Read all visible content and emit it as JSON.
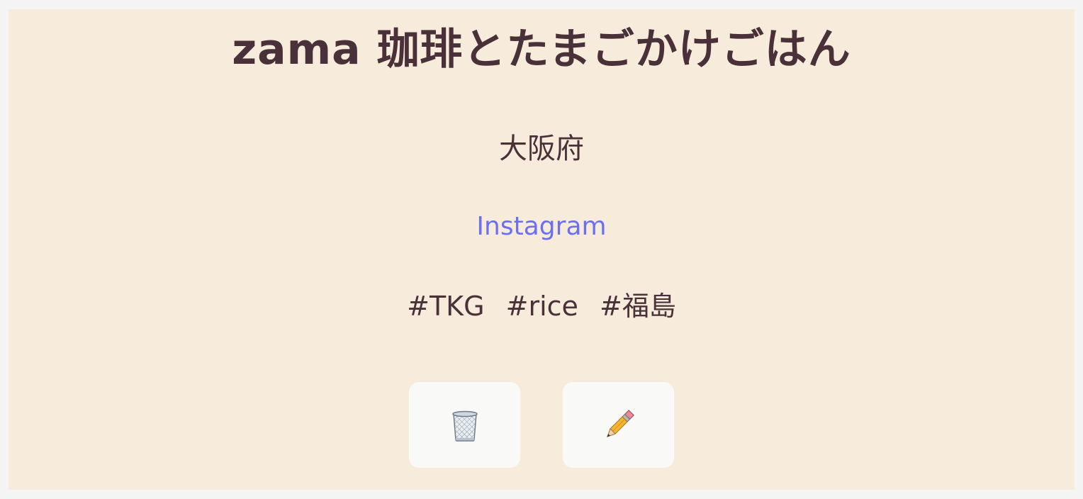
{
  "shop": {
    "name": "zama 珈琲とたまごかけごはん",
    "prefecture": "大阪府",
    "instagram_label": "Instagram",
    "tags": [
      "#TKG",
      "#rice",
      "#福島"
    ]
  },
  "actions": {
    "delete_icon": "wastebasket-icon",
    "edit_icon": "pencil-icon"
  },
  "colors": {
    "background": "#f4f4f5",
    "card": "#f7ecdc",
    "text": "#4a3139",
    "link": "#6b6ff0",
    "button": "#f9f9f8"
  }
}
